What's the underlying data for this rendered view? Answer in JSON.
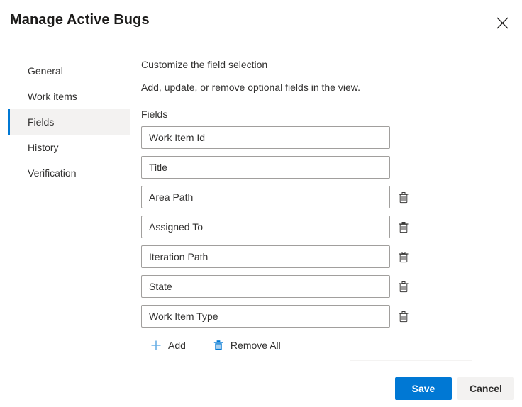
{
  "dialog": {
    "title": "Manage Active Bugs",
    "close_label": "Close",
    "close_icon": "close-icon"
  },
  "sidebar": {
    "items": [
      {
        "label": "General",
        "selected": false
      },
      {
        "label": "Work items",
        "selected": false
      },
      {
        "label": "Fields",
        "selected": true
      },
      {
        "label": "History",
        "selected": false
      },
      {
        "label": "Verification",
        "selected": false
      }
    ]
  },
  "main": {
    "heading": "Customize the field selection",
    "subtext": "Add, update, or remove optional fields in the view.",
    "fields_label": "Fields",
    "fields": [
      {
        "value": "Work Item Id",
        "placeholder": "Work Item Id",
        "deletable": false
      },
      {
        "value": "Title",
        "placeholder": "Title",
        "deletable": false
      },
      {
        "value": "Area Path",
        "placeholder": "Area Path",
        "deletable": true
      },
      {
        "value": "Assigned To",
        "placeholder": "Assigned To",
        "deletable": true
      },
      {
        "value": "Iteration Path",
        "placeholder": "Iteration Path",
        "deletable": true
      },
      {
        "value": "State",
        "placeholder": "State",
        "deletable": true
      },
      {
        "value": "Work Item Type",
        "placeholder": "Work Item Type",
        "deletable": true
      }
    ],
    "delete_row_label": "Delete field",
    "commands": {
      "add_label": "Add",
      "add_icon": "plus-icon",
      "remove_all_label": "Remove All",
      "remove_all_icon": "trash-icon"
    }
  },
  "footer": {
    "save_label": "Save",
    "cancel_label": "Cancel"
  },
  "colors": {
    "accent": "#0078d4",
    "accent_light": "#69afe5",
    "selected_background": "#f3f2f1",
    "input_border": "#a19f9d",
    "text": "#323130",
    "icon_gray": "#605e5c"
  }
}
